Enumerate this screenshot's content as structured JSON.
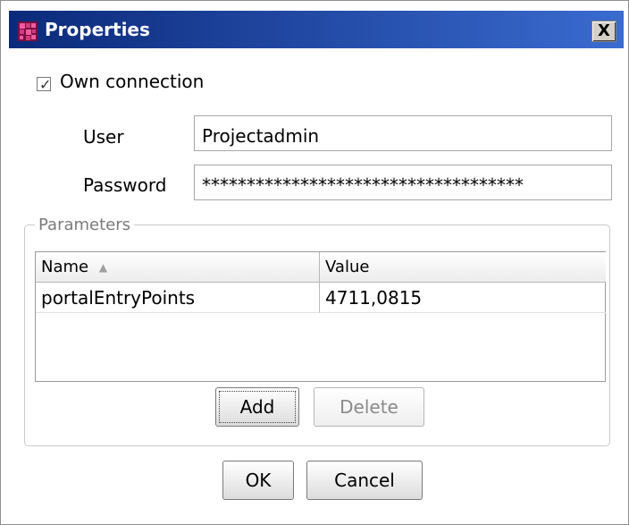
{
  "window": {
    "title": "Properties",
    "close_label": "X"
  },
  "own_connection": {
    "label": "Own connection",
    "checked": true
  },
  "fields": {
    "user": {
      "label": "User",
      "value": "Projectadmin"
    },
    "password": {
      "label": "Password",
      "value": "************************************"
    }
  },
  "parameters": {
    "legend": "Parameters",
    "columns": {
      "name": "Name",
      "value": "Value"
    },
    "rows": [
      {
        "name": "portalEntryPoints",
        "value": "4711,0815"
      }
    ],
    "buttons": {
      "add": "Add",
      "delete": "Delete"
    }
  },
  "dialog_buttons": {
    "ok": "OK",
    "cancel": "Cancel"
  },
  "icons": {
    "app": "app-icon",
    "close": "close-icon",
    "checkbox": "check-icon",
    "sort": "sort-up-icon"
  },
  "colors": {
    "title_gradient_start": "#0b2a7a",
    "title_gradient_end": "#3a6bd0"
  }
}
